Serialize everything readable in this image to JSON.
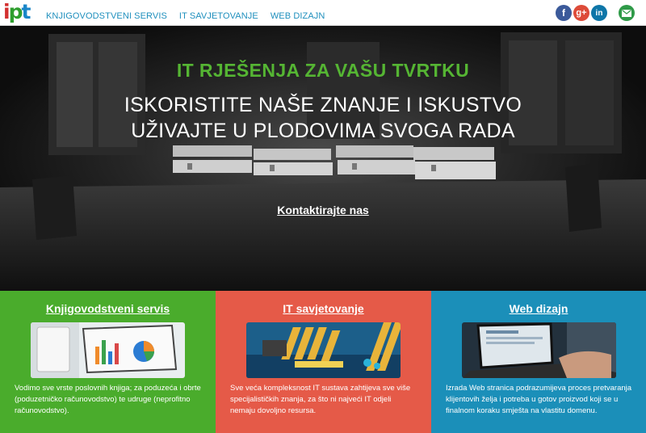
{
  "header": {
    "logo": {
      "i": "i",
      "p": "p",
      "t": "t"
    },
    "nav": [
      {
        "label": "KNJIGOVODSTVENI SERVIS"
      },
      {
        "label": "IT SAVJETOVANJE"
      },
      {
        "label": "WEB DIZAJN"
      }
    ],
    "social": {
      "facebook": "f",
      "googleplus": "g+",
      "linkedin": "in"
    }
  },
  "hero": {
    "title": "IT RJEŠENJA ZA VAŠU TVRTKU",
    "subtitle_line1": "ISKORISTITE NAŠE ZNANJE I ISKUSTVO",
    "subtitle_line2": "UŽIVAJTE U PLODOVIMA SVOGA RADA",
    "cta": "Kontaktirajte nas"
  },
  "services": [
    {
      "title": "Knjigovodstveni servis",
      "text": "Vodimo sve vrste poslovnih knjiga; za poduzeća i obrte (poduzetničko računovodstvo) te udruge (neprofitno računovodstvo).",
      "color": "#4aac2c"
    },
    {
      "title": "IT savjetovanje",
      "text": "Sve veća kompleksnost IT sustava zahtijeva sve više specijalističkih znanja, za što ni najveći IT odjeli nemaju dovoljno resursa.",
      "color": "#e55a48"
    },
    {
      "title": "Web dizajn",
      "text": "Izrada Web stranica podrazumijeva proces pretvaranja klijentovih želja i potreba u gotov proizvod koji se u finalnom koraku smješta na vlastitu domenu.",
      "color": "#1b8fb9"
    }
  ]
}
